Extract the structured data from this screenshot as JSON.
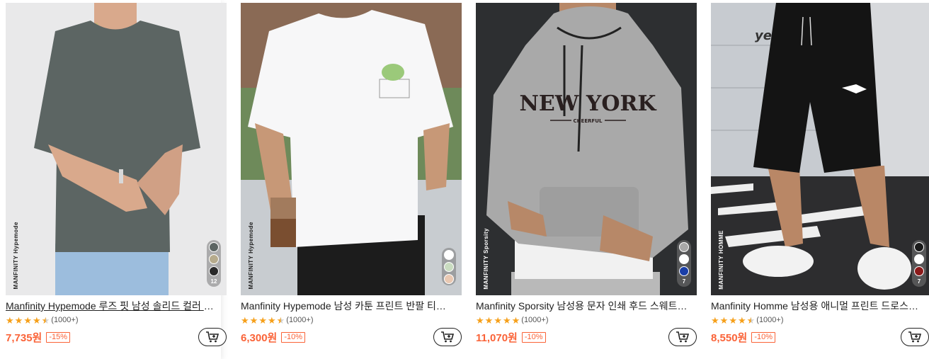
{
  "products": [
    {
      "title": "Manfinity Hypemode 루즈 핏 남성 솔리드 컬러 티셔츠",
      "brand_tag": "MANFINITY Hypemode",
      "rating_stars": 4.5,
      "review_count": "(1000+)",
      "price": "7,735원",
      "discount": "-15%",
      "swatches": [
        "#5c6563",
        "#b6ab8c",
        "#2a2a2a"
      ],
      "swatch_count": "12",
      "cart_icon": "cart-add-icon"
    },
    {
      "title": "Manfinity Hypemode 남성 카툰 프린트 반팔 티셔츠",
      "brand_tag": "MANFINITY Hypemode",
      "rating_stars": 4.5,
      "review_count": "(1000+)",
      "price": "6,300원",
      "discount": "-10%",
      "swatches": [
        "#ffffff",
        "#c9dcc0",
        "#e9c8b2"
      ],
      "swatch_count": "",
      "cart_icon": "cart-add-icon"
    },
    {
      "title": "Manfinity Sporsity 남성용 문자 인쇄 후드 스웨트셔츠",
      "brand_tag": "MANFINITY Sporsity",
      "rating_stars": 5,
      "review_count": "(1000+)",
      "price": "11,070원",
      "discount": "-10%",
      "swatches": [
        "#a8a8a8",
        "#ffffff",
        "#1a3fa8"
      ],
      "swatch_count": "7",
      "cart_icon": "cart-add-icon"
    },
    {
      "title": "Manfinity Homme 남성용 애니멀 프린트 드로스트링 반바지",
      "brand_tag": "MANFINITY HOMME",
      "rating_stars": 4.5,
      "review_count": "(1000+)",
      "price": "8,550원",
      "discount": "-10%",
      "swatches": [
        "#1a1a1a",
        "#ffffff",
        "#8b1a1a"
      ],
      "swatch_count": "7",
      "cart_icon": "cart-add-icon"
    }
  ],
  "image_text": {
    "hoodie_print": "NEW YORK",
    "hoodie_sub": "CHEERFUL",
    "wall_sign": "yes!"
  },
  "colors": {
    "price": "#fa6338",
    "star": "#f6a01a"
  }
}
